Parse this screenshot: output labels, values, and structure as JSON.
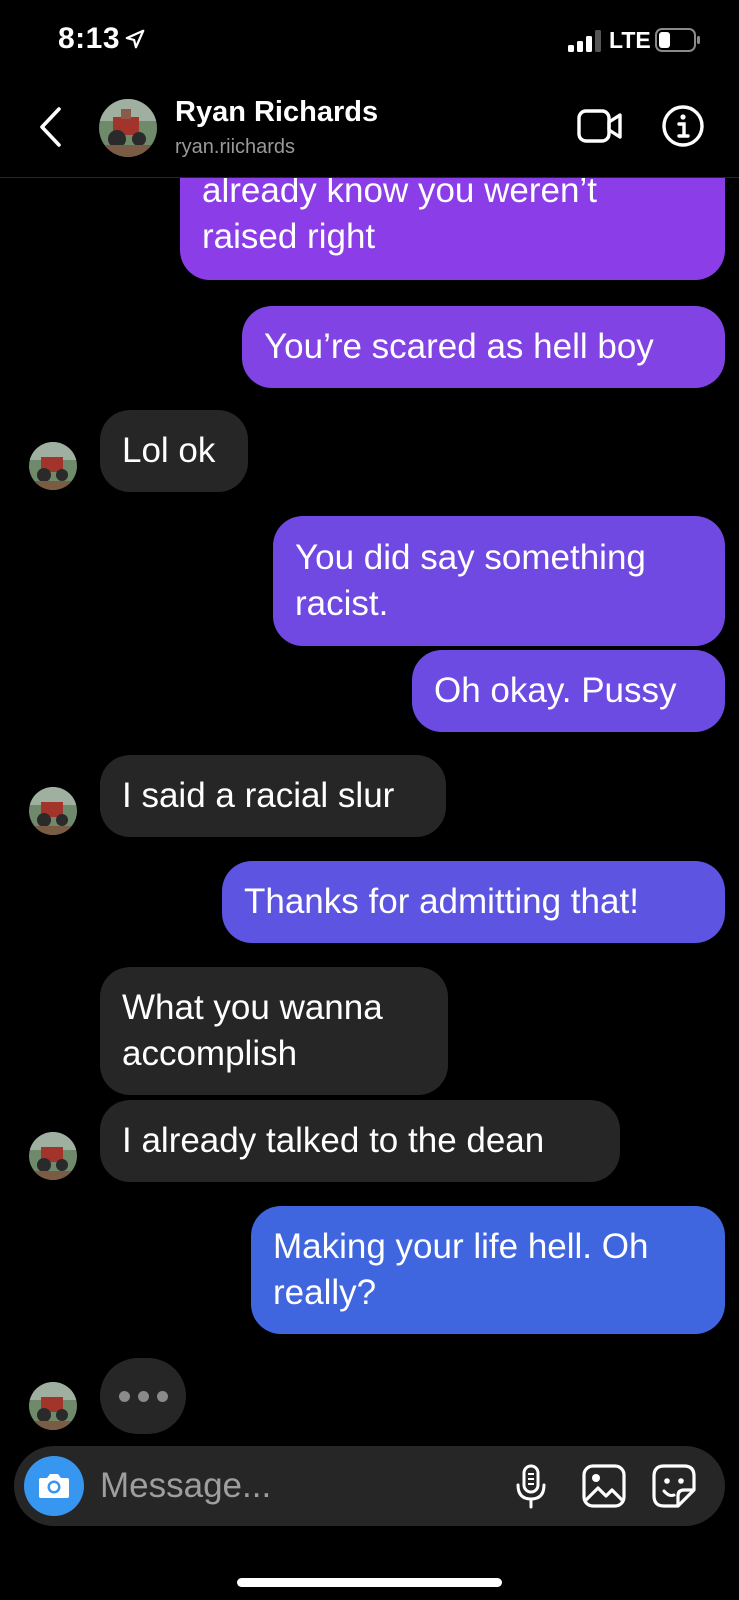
{
  "status_bar": {
    "time": "8:13",
    "network": "LTE",
    "icons": [
      "location-arrow-icon",
      "signal-bars-icon",
      "battery-icon"
    ]
  },
  "header": {
    "name": "Ryan Richards",
    "handle": "ryan.riichards",
    "icons": [
      "back-chevron-icon",
      "video-call-icon",
      "info-icon"
    ]
  },
  "messages": [
    {
      "from": "me",
      "lines": [
        "already know you weren’t",
        "raised right"
      ],
      "color": "#8b3ee8"
    },
    {
      "from": "me",
      "lines": [
        "You’re scared as hell boy"
      ],
      "color": "#8143e4"
    },
    {
      "from": "them",
      "lines": [
        "Lol ok"
      ]
    },
    {
      "from": "me",
      "lines": [
        "You did say something",
        "racist."
      ],
      "color": "#7048e2"
    },
    {
      "from": "me",
      "lines": [
        "Oh okay. Pussy"
      ],
      "color": "#6b4be2"
    },
    {
      "from": "them",
      "lines": [
        "I said a racial slur"
      ]
    },
    {
      "from": "me",
      "lines": [
        "Thanks for admitting that!"
      ],
      "color": "#5d54e2"
    },
    {
      "from": "them",
      "lines": [
        "What you wanna",
        "accomplish"
      ]
    },
    {
      "from": "them",
      "lines": [
        "I already talked to the dean"
      ]
    },
    {
      "from": "me",
      "lines": [
        "Making your life hell. Oh",
        "really?"
      ],
      "color": "#3f66df"
    }
  ],
  "typing_indicator": true,
  "composer": {
    "placeholder": "Message...",
    "icons": [
      "camera-icon",
      "microphone-icon",
      "gallery-icon",
      "sticker-icon"
    ]
  },
  "colors": {
    "background": "#000000",
    "incoming_bubble": "#262626",
    "camera_button": "#3797f0"
  }
}
